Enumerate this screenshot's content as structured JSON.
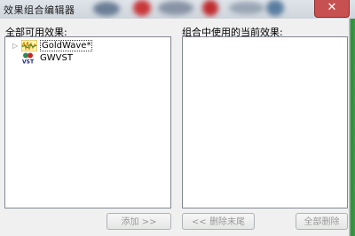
{
  "window": {
    "title": "效果组合编辑器",
    "close_glyph": "✕"
  },
  "left_panel": {
    "heading": "全部可用效果:",
    "items": [
      {
        "label": "GoldWave*",
        "icon": "goldwave-icon",
        "expander": "▷",
        "selected": true
      },
      {
        "label": "GWVST",
        "icon": "vst-icon",
        "expander": "",
        "selected": false
      }
    ]
  },
  "right_panel": {
    "heading": "组合中使用的当前效果:"
  },
  "buttons": {
    "add": "添加 >>",
    "remove_last": "<< 删除末尾",
    "remove_all": "全部删除"
  },
  "colors": {
    "close_red": "#c75050",
    "disabled_text": "#9a9a9a",
    "listbox_border": "#828790"
  }
}
